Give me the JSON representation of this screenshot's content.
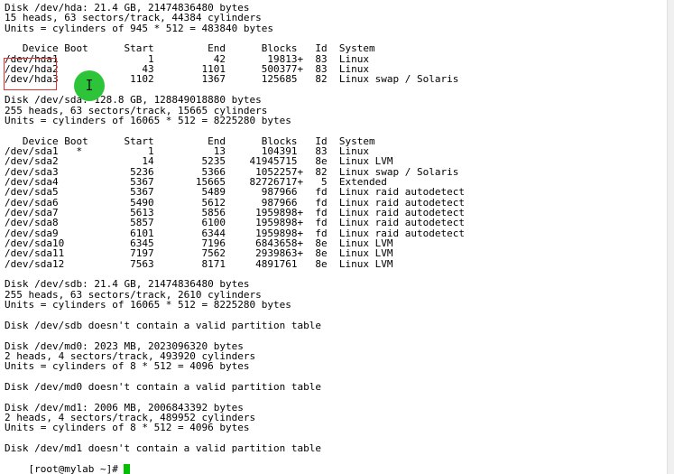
{
  "terminal": {
    "lines": [
      "Disk /dev/hda: 21.4 GB, 21474836480 bytes",
      "15 heads, 63 sectors/track, 44384 cylinders",
      "Units = cylinders of 945 * 512 = 483840 bytes",
      "",
      "   Device Boot      Start         End      Blocks   Id  System",
      "/dev/hda1               1          42       19813+  83  Linux",
      "/dev/hda2              43        1101      500377+  83  Linux",
      "/dev/hda3            1102        1367      125685   82  Linux swap / Solaris",
      "",
      "Disk /dev/sda: 128.8 GB, 128849018880 bytes",
      "255 heads, 63 sectors/track, 15665 cylinders",
      "Units = cylinders of 16065 * 512 = 8225280 bytes",
      "",
      "   Device Boot      Start         End      Blocks   Id  System",
      "/dev/sda1   *           1          13      104391   83  Linux",
      "/dev/sda2              14        5235    41945715   8e  Linux LVM",
      "/dev/sda3            5236        5366     1052257+  82  Linux swap / Solaris",
      "/dev/sda4            5367       15665    82726717+   5  Extended",
      "/dev/sda5            5367        5489      987966   fd  Linux raid autodetect",
      "/dev/sda6            5490        5612      987966   fd  Linux raid autodetect",
      "/dev/sda7            5613        5856     1959898+  fd  Linux raid autodetect",
      "/dev/sda8            5857        6100     1959898+  fd  Linux raid autodetect",
      "/dev/sda9            6101        6344     1959898+  fd  Linux raid autodetect",
      "/dev/sda10           6345        7196     6843658+  8e  Linux LVM",
      "/dev/sda11           7197        7562     2939863+  8e  Linux LVM",
      "/dev/sda12           7563        8171     4891761   8e  Linux LVM",
      "",
      "Disk /dev/sdb: 21.4 GB, 21474836480 bytes",
      "255 heads, 63 sectors/track, 2610 cylinders",
      "Units = cylinders of 16065 * 512 = 8225280 bytes",
      "",
      "Disk /dev/sdb doesn't contain a valid partition table",
      "",
      "Disk /dev/md0: 2023 MB, 2023096320 bytes",
      "2 heads, 4 sectors/track, 493920 cylinders",
      "Units = cylinders of 8 * 512 = 4096 bytes",
      "",
      "Disk /dev/md0 doesn't contain a valid partition table",
      "",
      "Disk /dev/md1: 2006 MB, 2006843392 bytes",
      "2 heads, 4 sectors/track, 489952 cylinders",
      "Units = cylinders of 8 * 512 = 4096 bytes",
      "",
      "Disk /dev/md1 doesn't contain a valid partition table"
    ],
    "prompt": "[root@mylab ~]# "
  },
  "colors": {
    "background": "#ffffff",
    "text": "#000000",
    "highlight_border": "#e53030",
    "marker": "#2ec43a",
    "cursor": "#00c000"
  },
  "icons": {
    "mouse_cursor": "ibeam-cursor-icon",
    "pointer_marker": "green-dot-marker"
  }
}
